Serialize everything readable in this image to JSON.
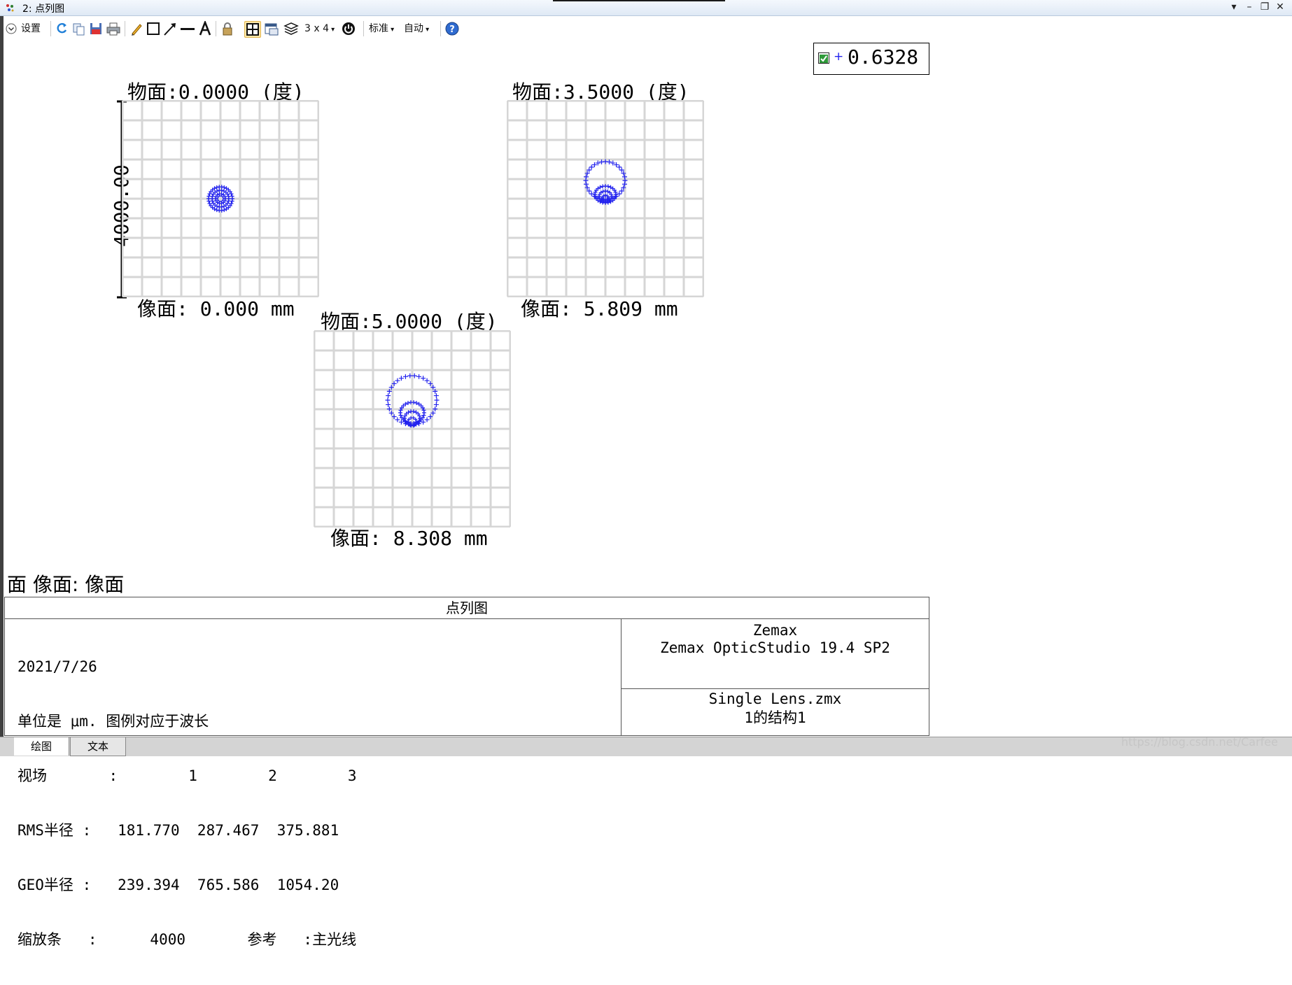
{
  "window": {
    "title": "2: 点列图"
  },
  "toolbar": {
    "settings_label": "设置",
    "layout_label": "3 x 4",
    "standard_label": "标准",
    "auto_label": "自动"
  },
  "legend": {
    "wavelength": "0.6328",
    "checked": true,
    "color": "#2222ee"
  },
  "scale_label": "4000.00",
  "plots": [
    {
      "title": "物面:0.0000 (度)",
      "caption": "像面: 0.000 mm"
    },
    {
      "title": "物面:3.5000 (度)",
      "caption": "像面: 5.809 mm"
    },
    {
      "title": "物面:5.0000 (度)",
      "caption": "像面: 8.308 mm"
    }
  ],
  "surface_label": "面 像面: 像面",
  "table": {
    "title": "点列图",
    "left_lines": [
      "2021/7/26",
      "单位是 μm. 图例对应于波长",
      "视场       :        1        2        3",
      "RMS半径 :   181.770  287.467  375.881",
      "GEO半径 :   239.394  765.586  1054.20",
      "缩放条   :      4000       参考   :主光线"
    ],
    "right_top": [
      "Zemax",
      "Zemax OpticStudio 19.4 SP2"
    ],
    "right_bottom": [
      "Single Lens.zmx",
      "1的结构1"
    ]
  },
  "tabs": {
    "plot": "绘图",
    "text": "文本"
  },
  "watermark": "https://blog.csdn.net/Carfee"
}
